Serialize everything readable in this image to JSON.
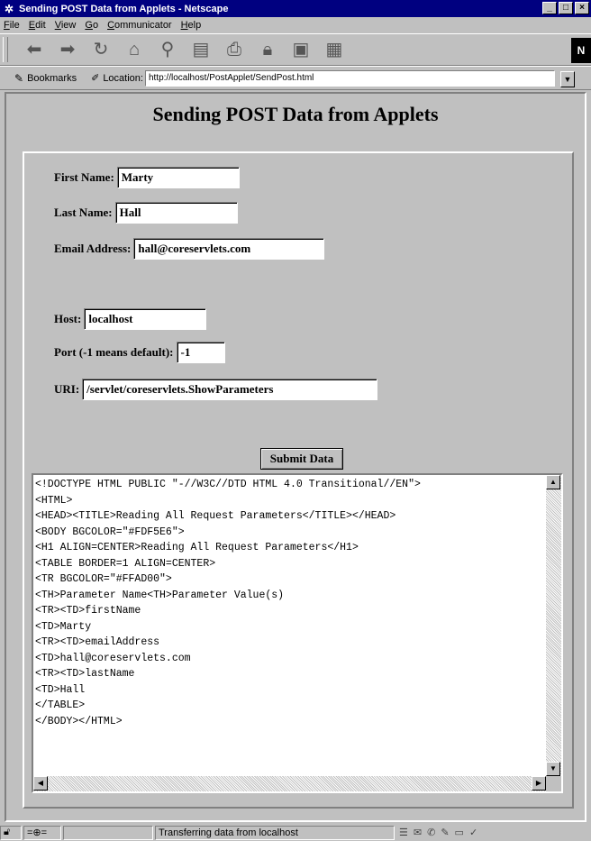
{
  "window": {
    "title": "Sending POST Data from Applets - Netscape",
    "buttons": [
      "_",
      "□",
      "×"
    ]
  },
  "menu": {
    "items": [
      "File",
      "Edit",
      "View",
      "Go",
      "Communicator",
      "Help"
    ]
  },
  "toolbar": {
    "icons": [
      "back-icon",
      "forward-icon",
      "reload-icon",
      "home-icon",
      "search-icon",
      "my-netscape-icon",
      "print-icon",
      "security-icon",
      "images-icon",
      "stop-icon"
    ],
    "logo": "N"
  },
  "location_bar": {
    "bookmarks_label": "Bookmarks",
    "location_label": "Location:",
    "url": "http://localhost/PostApplet/SendPost.html"
  },
  "page": {
    "heading": "Sending POST Data from Applets"
  },
  "form": {
    "first_name_label": "First Name:",
    "first_name_value": "Marty",
    "last_name_label": "Last Name:",
    "last_name_value": "Hall",
    "email_label": "Email Address:",
    "email_value": "hall@coreservlets.com",
    "host_label": "Host:",
    "host_value": "localhost",
    "port_label": "Port (-1 means default):",
    "port_value": "-1",
    "uri_label": "URI:",
    "uri_value": "/servlet/coreservlets.ShowParameters",
    "submit_label": "Submit Data"
  },
  "response": {
    "lines": [
      "<!DOCTYPE HTML PUBLIC \"-//W3C//DTD HTML 4.0 Transitional//EN\">",
      "<HTML>",
      "<HEAD><TITLE>Reading All Request Parameters</TITLE></HEAD>",
      "<BODY BGCOLOR=\"#FDF5E6\">",
      "<H1 ALIGN=CENTER>Reading All Request Parameters</H1>",
      "<TABLE BORDER=1 ALIGN=CENTER>",
      "<TR BGCOLOR=\"#FFAD00\">",
      "<TH>Parameter Name<TH>Parameter Value(s)",
      "<TR><TD>firstName",
      "<TD>Marty",
      "<TR><TD>emailAddress",
      "<TD>hall@coreservlets.com",
      "<TR><TD>lastName",
      "<TD>Hall",
      "</TABLE>",
      "</BODY></HTML>"
    ]
  },
  "status": {
    "text": "Transferring data from localhost"
  }
}
